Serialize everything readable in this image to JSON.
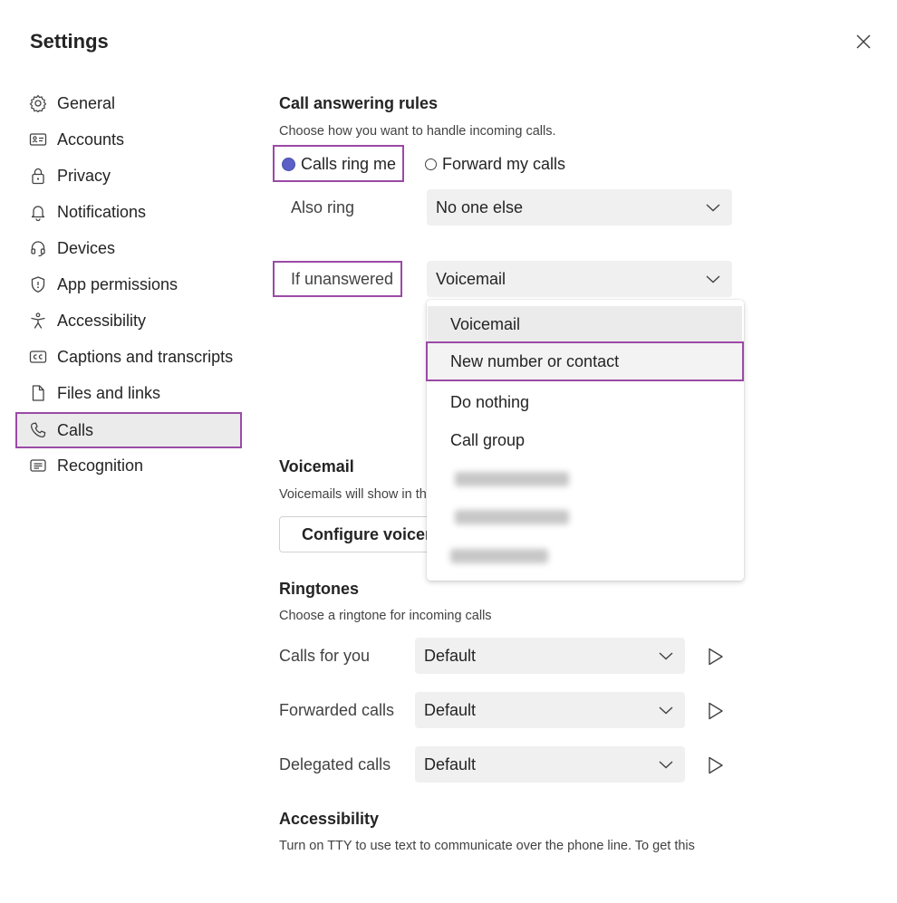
{
  "header": {
    "title": "Settings"
  },
  "sidebar": {
    "items": [
      {
        "label": "General",
        "icon": "gear-icon"
      },
      {
        "label": "Accounts",
        "icon": "id-card-icon"
      },
      {
        "label": "Privacy",
        "icon": "lock-icon"
      },
      {
        "label": "Notifications",
        "icon": "bell-icon"
      },
      {
        "label": "Devices",
        "icon": "headset-icon"
      },
      {
        "label": "App permissions",
        "icon": "shield-icon"
      },
      {
        "label": "Accessibility",
        "icon": "accessibility-icon"
      },
      {
        "label": "Captions and transcripts",
        "icon": "cc-icon"
      },
      {
        "label": "Files and links",
        "icon": "document-icon"
      },
      {
        "label": "Calls",
        "icon": "phone-icon",
        "active": true
      },
      {
        "label": "Recognition",
        "icon": "recognition-icon"
      }
    ]
  },
  "call_rules": {
    "heading": "Call answering rules",
    "description": "Choose how you want to handle incoming calls.",
    "option_ring": "Calls ring me",
    "option_forward": "Forward my calls",
    "selected": "Calls ring me",
    "also_ring_label": "Also ring",
    "also_ring_value": "No one else",
    "unanswered_label": "If unanswered",
    "unanswered_value": "Voicemail"
  },
  "dropdown": {
    "options": [
      "Voicemail",
      "New number or contact",
      "Do nothing",
      "Call group"
    ],
    "hovered": "Voicemail",
    "focused": "New number or contact"
  },
  "voicemail": {
    "heading": "Voicemail",
    "description": "Voicemails will show in th",
    "button": "Configure voicem"
  },
  "ringtones": {
    "heading": "Ringtones",
    "description": "Choose a ringtone for incoming calls",
    "rows": [
      {
        "label": "Calls for you",
        "value": "Default"
      },
      {
        "label": "Forwarded calls",
        "value": "Default"
      },
      {
        "label": "Delegated calls",
        "value": "Default"
      }
    ]
  },
  "accessibility": {
    "heading": "Accessibility",
    "description": "Turn on TTY to use text to communicate over the phone line. To get this"
  },
  "colors": {
    "accent": "#5b5fc7",
    "highlight": "#9b4aa6",
    "field_bg": "#f0f0f0"
  }
}
